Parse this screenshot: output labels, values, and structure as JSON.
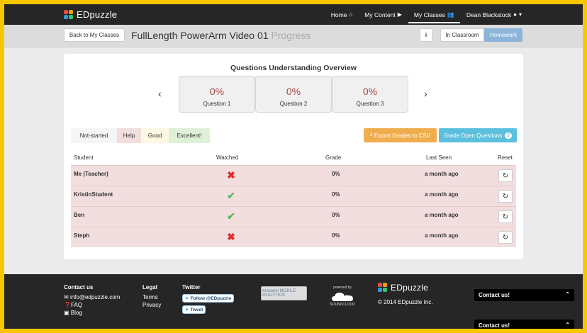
{
  "brand": {
    "name": "EDpuzzle"
  },
  "nav": {
    "home": "Home",
    "my_content": "My Content",
    "my_classes": "My Classes",
    "user": "Dean Blackstock"
  },
  "subheader": {
    "back_label": "Back to My Classes",
    "title": "FullLength PowerArm Video 01",
    "title_suffix": "Progress",
    "info_label": "i",
    "in_classroom_label": "In Classroom",
    "homework_label": "Homework"
  },
  "overview": {
    "title": "Questions Understanding Overview",
    "prev_icon": "chevron-left-icon",
    "next_icon": "chevron-right-icon",
    "questions": [
      {
        "percent": "0%",
        "label": "Question 1"
      },
      {
        "percent": "0%",
        "label": "Question 2"
      },
      {
        "percent": "0%",
        "label": "Question 3"
      }
    ]
  },
  "legend": {
    "not_started": "Not-started",
    "help": "Help",
    "good": "Good",
    "excellent": "Excellent!"
  },
  "actions": {
    "export_label": "Export Grades to CSV",
    "grade_open_label": "Grade Open Questions",
    "grade_open_count": "8"
  },
  "table": {
    "headers": {
      "student": "Student",
      "watched": "Watched",
      "grade": "Grade",
      "last_seen": "Last Seen",
      "reset": "Reset"
    },
    "rows": [
      {
        "student": "Me (Teacher)",
        "watched": false,
        "grade": "0%",
        "last_seen": "a month ago"
      },
      {
        "student": "KristinStudent",
        "watched": true,
        "grade": "0%",
        "last_seen": "a month ago"
      },
      {
        "student": "Ben",
        "watched": true,
        "grade": "0%",
        "last_seen": "a month ago"
      },
      {
        "student": "Steph",
        "watched": false,
        "grade": "0%",
        "last_seen": "a month ago"
      }
    ]
  },
  "footer": {
    "contact": {
      "heading": "Contact us",
      "email": "info@edpuzzle.com",
      "faq": "FAQ",
      "blog": "Blog"
    },
    "legal": {
      "heading": "Legal",
      "terms": "Terms",
      "privacy": "Privacy"
    },
    "twitter": {
      "heading": "Twitter",
      "follow": "Follow @EDpuzzle",
      "tweet": "Tweet"
    },
    "mixpanel": "mixpanel MOBILE ANALYTICS",
    "soundcloud_powered": "powered by",
    "soundcloud_name": "SOUNDCLOUD",
    "copyright": "© 2014 EDpuzzle Inc.",
    "contact_widget": "Contact us!"
  },
  "colors": {
    "topbar": "#262626",
    "accent_blue": "#8db4d9",
    "help_red": "#f2dede",
    "warning": "#f0ad4e",
    "info": "#5bc0de",
    "frame_yellow": "#f7c600"
  }
}
